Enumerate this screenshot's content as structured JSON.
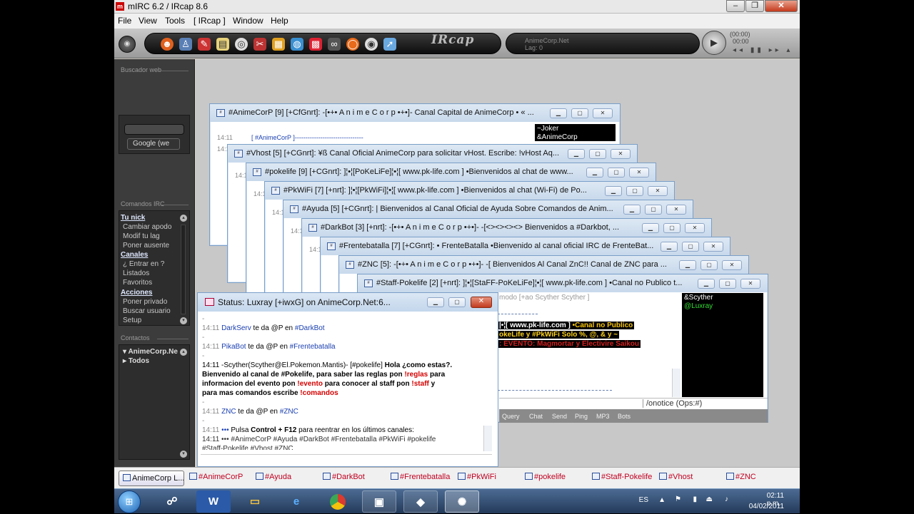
{
  "window": {
    "title": "mIRC 6.2 / IRcap 8.6",
    "minimize": "–",
    "restore": "❐",
    "close": "✕"
  },
  "menu": [
    "File",
    "View",
    "Tools",
    "[ IRcap ]",
    "Window",
    "Help"
  ],
  "toolbar": {
    "logo": "IRcap",
    "network": "AnimeCorp.Net",
    "lag": "Lag: 0",
    "media_time": "(00:00)",
    "media_counter": "00:00"
  },
  "sidebar": {
    "search_header": "Buscador web",
    "google_button": "Google (we",
    "commands_header": "Comandos IRC",
    "nick_category": "Tu nick",
    "nick_items": [
      "Cambiar apodo",
      "Modif tu lag",
      "Poner ausente"
    ],
    "channels_category": "Canales",
    "channel_items": [
      "¿ Entrar en ?",
      "Listados",
      "Favoritos"
    ],
    "actions_category": "Acciones",
    "action_items": [
      "Poner privado",
      "Buscar usuario",
      "Setup"
    ],
    "contacts_header": "Contactos",
    "contacts_tree": [
      "AnimeCorp.Ne",
      "Todos"
    ]
  },
  "channel_windows": [
    {
      "title": "#AnimeCorP [9] [+CfGnrt]:  -[•+• A n i m e C o r p •+•]- Canal Capital de AnimeCorp • « ..."
    },
    {
      "title": "#Vhost [5] [+CGnrt]: ¥ß Canal Oficial AnimeCorp para solicitar vHost. Escribe: !vHost Aq..."
    },
    {
      "title": "#pokelife [9] [+CGnrt]: ]¦•¦[PoKeLiFe]¦•¦[ www.pk-life.com ] •Bienvenidos al chat de  www..."
    },
    {
      "title": "#PkWiFi [7] [+nrt]: ]¦•¦[PkWiFi]¦•¦[ www.pk-life.com ] •Bienvenidos al chat (Wi-Fi) de Po..."
    },
    {
      "title": "#Ayuda [5] [+CGnrt]: | Bienvenidos al Canal Oficial de Ayuda Sobre Comandos de Anim..."
    },
    {
      "title": "#DarkBot [3] [+nrt]:   -[•+• A n i m e C o r p •+•]- -[<><><><> Bienvenidos a #Darkbot, ..."
    },
    {
      "title": "#Frentebatalla [7] [+CGnrt]: • FrenteBatalla •Bienvenido al canal oficial IRC de FrenteBat..."
    },
    {
      "title": "#ZNC [5]:  -[•+• A n i m e C o r p •+•]- -[ Bienvenidos Al Canal ZnC!! Canal de ZNC para ..."
    },
    {
      "title": "#Staff-Pokelife [2] [+nrt]: ]¦•¦[StaFF-PoKeLiFe]¦•¦[ www.pk-life.com ] •Canal no Publico t..."
    }
  ],
  "animecorp_window": {
    "line_time": "14:11",
    "line_text": "[ #AnimeCorP ]--------------------------------",
    "nicks": [
      "~Joker",
      "&AnimeCorp"
    ]
  },
  "back_timestamps": "14:11",
  "staff_window": {
    "mode_line": "modo [+ao Scyther Scyther ]",
    "highlight1_a": "|•¦[ www.pk-life.com ] ",
    "highlight1_b": "•Canal no Publico",
    "highlight2": "okeLife y #PkWiFi Solo %, @, & y ~",
    "highlight3": ": EVENTO: Magmortar y Electivire Saikou",
    "nicks": [
      "&Scyther",
      "@Luxray"
    ],
    "nick_colors": [
      "#ffffff",
      "#33dd33"
    ],
    "topic_input": "/onotice (Ops:#)",
    "tabs": [
      "Query",
      "Chat",
      "Send",
      "Ping",
      "MP3",
      "Bots"
    ]
  },
  "status_window": {
    "title": "Status: Luxray [+iwxG] on AnimeCorp.Net:6...",
    "lines": [
      {
        "time": "14:11",
        "nick": "DarkServ",
        "text": " te da @P en ",
        "chan": "#DarkBot"
      },
      {
        "time": "14:11",
        "nick": "PikaBot",
        "text": " te da @P en ",
        "chan": "#Frentebatalla"
      },
      {
        "time": "14:11",
        "nick": "ZNC",
        "text": " te da @P en ",
        "chan": "#ZNC"
      }
    ],
    "scyther_prefix": "14:11 -Scyther(Scyther@El.Pokemon.Mantis)- [#pokelife] ",
    "scyther_msg1": "Hola ¿como estas?.",
    "scyther_msg2a": "Bienvenido al canal de #Pokelife, para saber las reglas pon ",
    "scyther_reglas": "!reglas",
    "scyther_msg2b": " para",
    "scyther_msg3a": "informacion del evento pon ",
    "scyther_evento": "!evento",
    "scyther_msg3b": " para conocer al staff pon ",
    "scyther_staff": "!staff",
    "scyther_msg3c": " y",
    "scyther_msg4a": "para mas comandos escribe ",
    "scyther_comandos": "!comandos",
    "separator": "-",
    "reconnect_time": "14:11",
    "reconnect_dots": " ••• ",
    "reconnect_a": "Pulsa ",
    "reconnect_keys": "Control + F12",
    "reconnect_b": " para reentrar en los últimos canales:",
    "chanlist1": "14:11 ••• #AnimeCorP #Ayuda #DarkBot #Frentebatalla #PkWiFi #pokelife",
    "chanlist2": "#Staff-Pokelife #Vhost #ZNC"
  },
  "switchbar": [
    "AnimeCorp L...",
    "#AnimeCorP",
    "#Ayuda",
    "#DarkBot",
    "#Frentebatalla",
    "#PkWiFi",
    "#pokelife",
    "#Staff-Pokelife",
    "#Vhost",
    "#ZNC"
  ],
  "taskbar": {
    "lang": "ES",
    "time": "02:11 p.m.",
    "date": "04/02/2011"
  }
}
